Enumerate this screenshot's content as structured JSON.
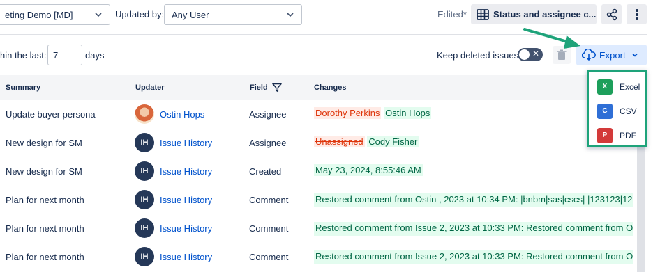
{
  "topbar": {
    "project_select": "eting Demo [MD]",
    "updated_by_label": "Updated by:",
    "updated_by_select": "Any User",
    "edited_label": "Edited*",
    "view_button": "Status and assignee c..."
  },
  "filter": {
    "within_label": "hin the last:",
    "days_value": "7",
    "days_label": "days",
    "keep_deleted_label": "Keep deleted issues",
    "export_label": "Export"
  },
  "export_menu": [
    {
      "label": "Excel",
      "icon": "excel-icon",
      "color": "#1d9f5b",
      "glyph": "X"
    },
    {
      "label": "CSV",
      "icon": "csv-icon",
      "color": "#2f6fd6",
      "glyph": "C"
    },
    {
      "label": "PDF",
      "icon": "pdf-icon",
      "color": "#d33a3a",
      "glyph": "P"
    }
  ],
  "table": {
    "headers": {
      "summary": "Summary",
      "updater": "Updater",
      "field": "Field",
      "changes": "Changes"
    },
    "rows": [
      {
        "summary": "Update buyer persona",
        "updater": "Ostin Hops",
        "avatar": "photo",
        "field": "Assignee",
        "removed": "Dorothy Perkins",
        "added": "Ostin Hops"
      },
      {
        "summary": "New design for SM",
        "updater": "Issue History",
        "avatar": "IH",
        "field": "Assignee",
        "removed": "Unassigned",
        "added": "Cody Fisher"
      },
      {
        "summary": "New design for SM",
        "updater": "Issue History",
        "avatar": "IH",
        "field": "Created",
        "added": "May 23, 2024, 8:55:46 AM"
      },
      {
        "summary": "Plan for next month",
        "updater": "Issue History",
        "avatar": "IH",
        "field": "Comment",
        "long": "Restored comment from Ostin , 2023 at 10:34 PM: |bnbm|sas|cscs| |123123|12..."
      },
      {
        "summary": "Plan for next month",
        "updater": "Issue History",
        "avatar": "IH",
        "field": "Comment",
        "long": "Restored comment from Issue 2, 2023 at 10:33 PM: Restored comment from O..."
      },
      {
        "summary": "Plan for next month",
        "updater": "Issue History",
        "avatar": "IH",
        "field": "Comment",
        "long": "Restored comment from Issue 2, 2023 at 10:33 PM: Restored comment from O..."
      }
    ]
  }
}
